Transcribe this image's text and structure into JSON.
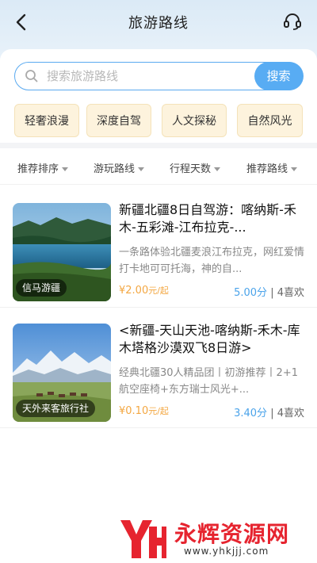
{
  "header": {
    "title": "旅游路线",
    "back_icon": "chevron-left-icon",
    "support_icon": "headset-icon"
  },
  "search": {
    "placeholder": "搜索旅游路线",
    "value": "",
    "button_label": "搜索",
    "accent_color": "#58acf3"
  },
  "tags": [
    {
      "label": "轻奢浪漫"
    },
    {
      "label": "深度自驾"
    },
    {
      "label": "人文探秘"
    },
    {
      "label": "自然风光"
    }
  ],
  "filters": [
    {
      "label": "推荐排序"
    },
    {
      "label": "游玩路线"
    },
    {
      "label": "行程天数"
    },
    {
      "label": "推荐路线"
    }
  ],
  "routes": [
    {
      "title": "新疆北疆8日自驾游：喀纳斯-禾木-五彩滩-江布拉克-...",
      "description": "一条路体验北疆麦浪江布拉克，网红爱情打卡地可可托海，神的自...",
      "agency": "信马游疆",
      "price": "¥2.00",
      "price_unit": "元/起",
      "score": "5.00分",
      "likes": "| 4喜欢"
    },
    {
      "title": "<新疆-天山天池-喀纳斯-禾木-库木塔格沙漠双飞8日游>",
      "description": "经典北疆30人精品团丨初游推荐丨2+1航空座椅+东方瑞士风光+...",
      "agency": "天外来客旅行社",
      "price": "¥0.10",
      "price_unit": "元/起",
      "score": "3.40分",
      "likes": "| 4喜欢"
    }
  ],
  "watermark": {
    "brand": "永辉资源网",
    "url": "www.yhkjjj.com",
    "brand_color": "#e6242f"
  }
}
